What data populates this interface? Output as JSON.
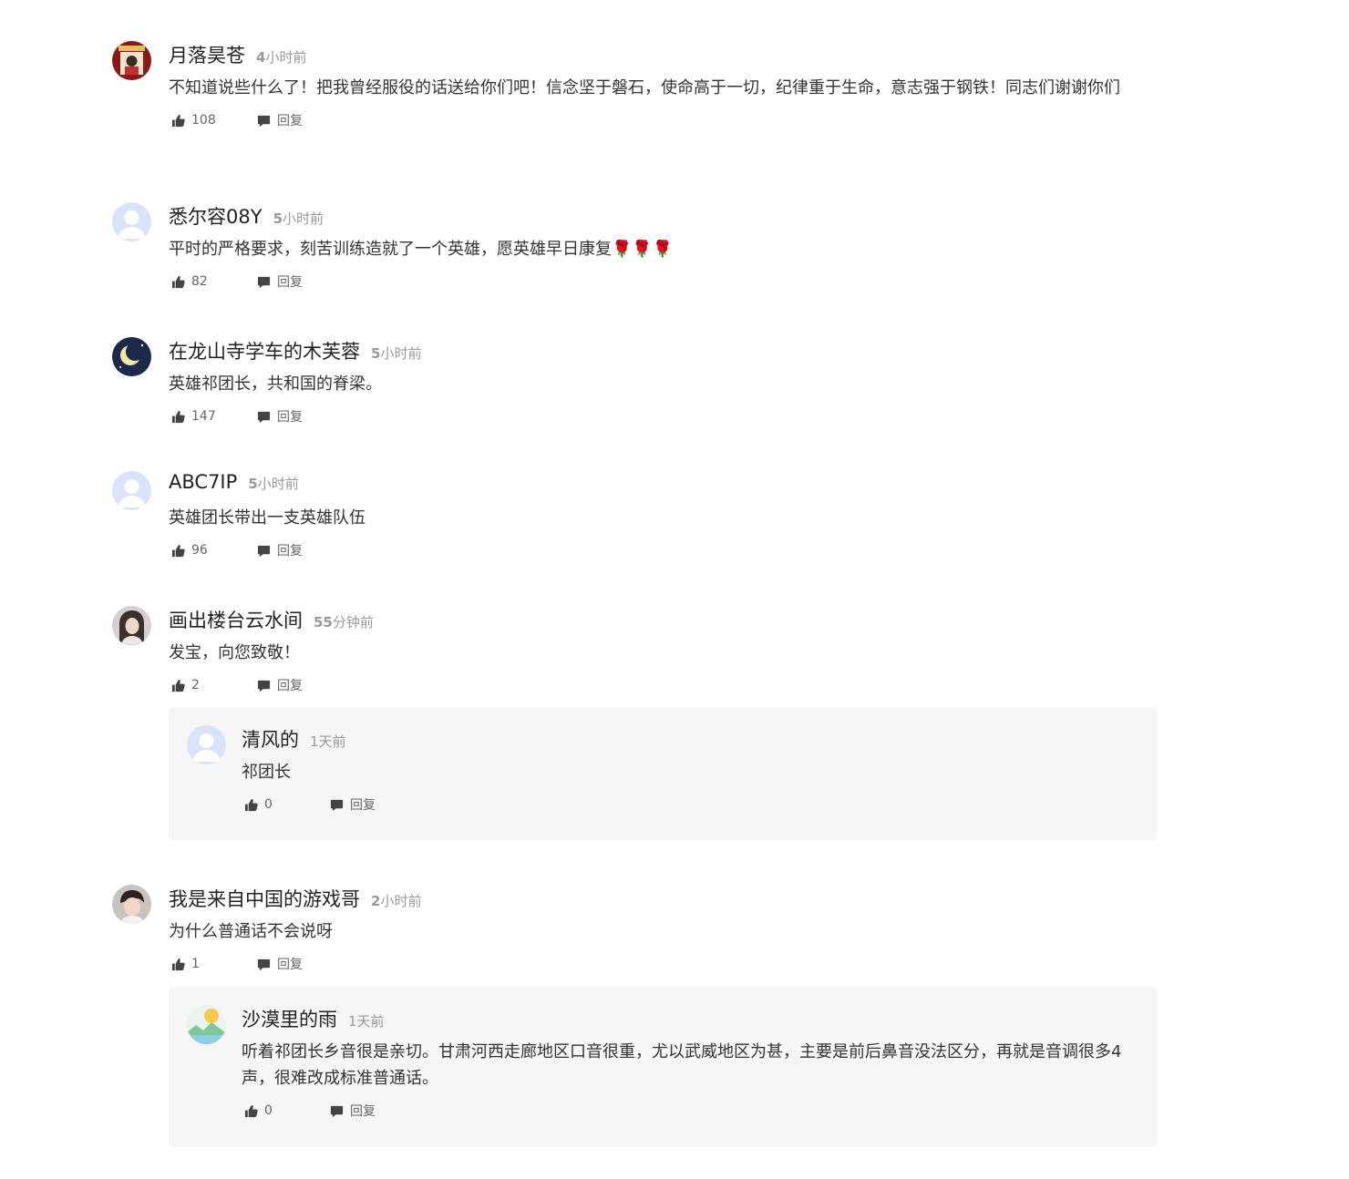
{
  "reply_label": "回复",
  "comments": [
    {
      "name": "月落昊苍",
      "time_num": "4",
      "time_unit": "小时前",
      "text": "不知道说些什么了！把我曾经服役的话送给你们吧！信念坚于磐石，使命高于一切，纪律重于生命，意志强于钢铁！同志们谢谢你们",
      "likes": "108",
      "avatar": "photo-avatar-red"
    },
    {
      "name": "悉尔容08Y",
      "time_num": "5",
      "time_unit": "小时前",
      "text": "平时的严格要求，刻苦训练造就了一个英雄，愿英雄早日康复🌹🌹🌹",
      "likes": "82",
      "avatar": "default-avatar"
    },
    {
      "name": "在龙山寺学车的木芙蓉",
      "time_num": "5",
      "time_unit": "小时前",
      "text": "英雄祁团长，共和国的脊梁。",
      "likes": "147",
      "avatar": "moon-avatar"
    },
    {
      "name": "ABC7IP",
      "time_num": "5",
      "time_unit": "小时前",
      "text": "英雄团长带出一支英雄队伍",
      "likes": "96",
      "avatar": "default-avatar"
    },
    {
      "name": "画出楼台云水间",
      "time_num": "55",
      "time_unit": "分钟前",
      "text": "发宝，向您致敬！",
      "likes": "2",
      "avatar": "photo-avatar-girl",
      "reply": {
        "name": "清风的",
        "time": "1天前",
        "text": "祁团长",
        "likes": "0",
        "avatar": "default-avatar"
      }
    },
    {
      "name": "我是来自中国的游戏哥",
      "time_num": "2",
      "time_unit": "小时前",
      "text": "为什么普通话不会说呀",
      "likes": "1",
      "avatar": "photo-avatar-boy",
      "reply": {
        "name": "沙漠里的雨",
        "time": "1天前",
        "text": "听着祁团长乡音很是亲切。甘肃河西走廊地区口音很重，尤以武威地区为甚，主要是前后鼻音没法区分，再就是音调很多4声，很难改成标准普通话。",
        "likes": "0",
        "avatar": "landscape-avatar"
      }
    }
  ]
}
